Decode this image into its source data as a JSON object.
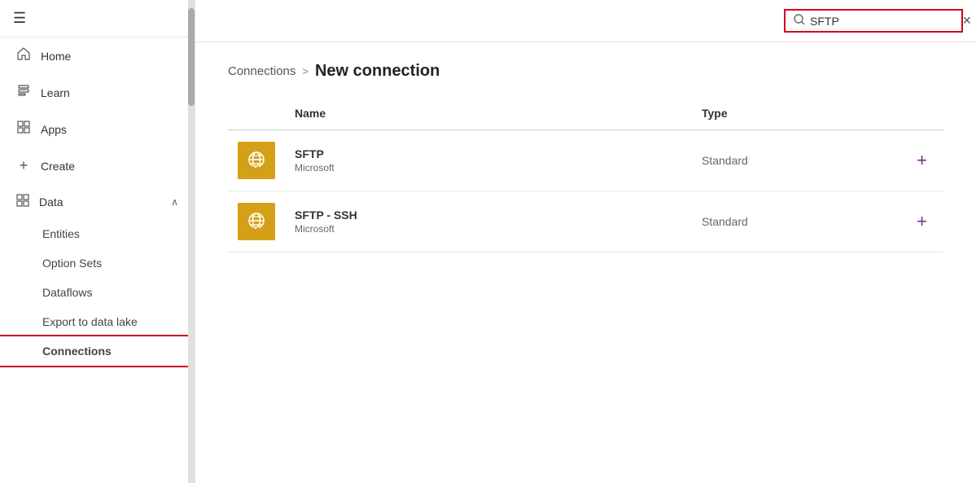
{
  "sidebar": {
    "hamburger_label": "☰",
    "items": [
      {
        "id": "home",
        "label": "Home",
        "icon": "⌂"
      },
      {
        "id": "learn",
        "label": "Learn",
        "icon": "📖"
      },
      {
        "id": "apps",
        "label": "Apps",
        "icon": "▦"
      },
      {
        "id": "create",
        "label": "Create",
        "icon": "+"
      },
      {
        "id": "data",
        "label": "Data",
        "icon": "▦",
        "expandable": true,
        "expanded": true
      }
    ],
    "sub_items": [
      {
        "id": "entities",
        "label": "Entities"
      },
      {
        "id": "option-sets",
        "label": "Option Sets"
      },
      {
        "id": "dataflows",
        "label": "Dataflows"
      },
      {
        "id": "export",
        "label": "Export to data lake"
      },
      {
        "id": "connections",
        "label": "Connections",
        "active": true
      }
    ]
  },
  "header": {
    "search_value": "SFTP",
    "search_placeholder": "Search",
    "close_label": "✕"
  },
  "breadcrumb": {
    "parent": "Connections",
    "separator": ">",
    "current": "New connection"
  },
  "table": {
    "columns": [
      {
        "id": "icon",
        "label": ""
      },
      {
        "id": "name",
        "label": "Name"
      },
      {
        "id": "type",
        "label": "Type"
      },
      {
        "id": "action",
        "label": ""
      }
    ],
    "rows": [
      {
        "id": "sftp",
        "name": "SFTP",
        "subtitle": "Microsoft",
        "type": "Standard",
        "add_label": "+"
      },
      {
        "id": "sftp-ssh",
        "name": "SFTP - SSH",
        "subtitle": "Microsoft",
        "type": "Standard",
        "add_label": "+"
      }
    ]
  }
}
